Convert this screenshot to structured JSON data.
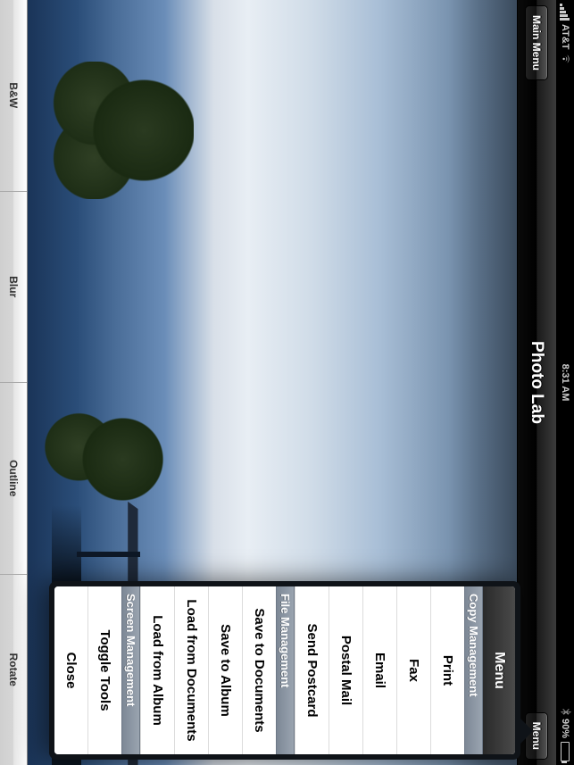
{
  "statusBar": {
    "carrier": "AT&T",
    "time": "8:31 AM",
    "batteryPercent": "90%"
  },
  "navBar": {
    "leftButton": "Main Menu",
    "title": "Photo Lab",
    "rightButton": "Menu"
  },
  "toolbar": {
    "items": [
      "B&W",
      "Blur",
      "Outline",
      "Rotate"
    ]
  },
  "popover": {
    "title": "Menu",
    "sections": [
      {
        "header": "Copy Management",
        "items": [
          "Print",
          "Fax",
          "Email",
          "Postal Mail",
          "Send Postcard"
        ]
      },
      {
        "header": "File Management",
        "items": [
          "Save to Documents",
          "Save to Album",
          "Load from Documents",
          "Load from Album"
        ]
      },
      {
        "header": "Screen Management",
        "items": [
          "Toggle Tools",
          "Close"
        ]
      }
    ]
  }
}
